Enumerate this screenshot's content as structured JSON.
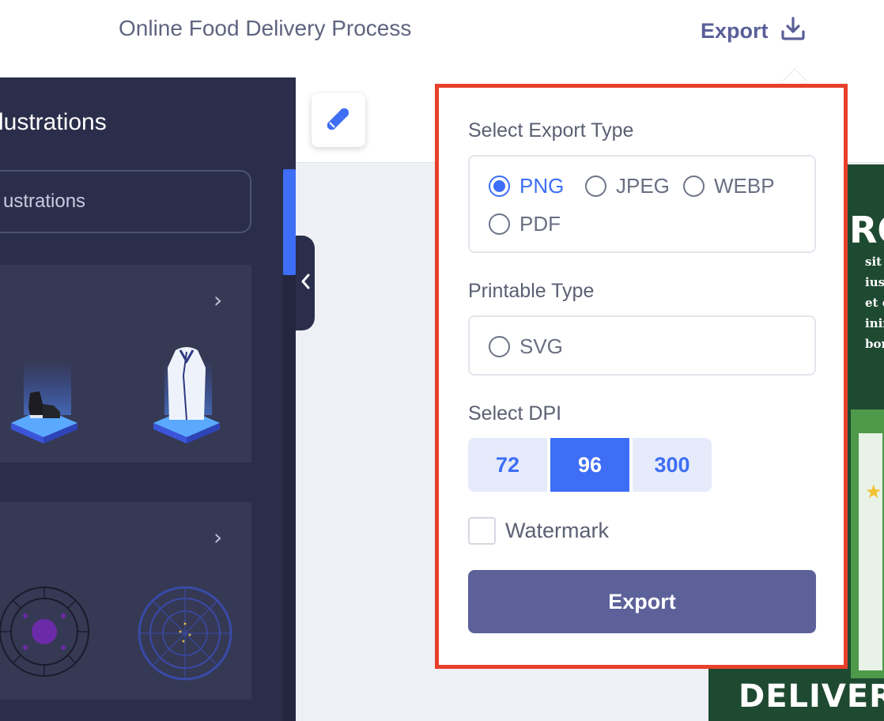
{
  "header": {
    "doc_title": "Online Food Delivery Process",
    "export_label": "Export"
  },
  "sidebar": {
    "title": "lustrations",
    "search_label": "ustrations"
  },
  "poster": {
    "title": "RO",
    "lines": [
      "sit am",
      "iusmo",
      "et do",
      "inim v",
      "boris a"
    ],
    "delivery": "DELIVERY"
  },
  "export_panel": {
    "export_type_label": "Select Export Type",
    "export_types": [
      {
        "label": "PNG",
        "checked": true
      },
      {
        "label": "JPEG",
        "checked": false
      },
      {
        "label": "WEBP",
        "checked": false
      },
      {
        "label": "PDF",
        "checked": false
      }
    ],
    "printable_type_label": "Printable Type",
    "printable_types": [
      {
        "label": "SVG",
        "checked": false
      }
    ],
    "dpi_label": "Select DPI",
    "dpi_options": [
      "72",
      "96",
      "300"
    ],
    "dpi_selected": "96",
    "watermark_label": "Watermark",
    "watermark_checked": false,
    "export_button_label": "Export"
  },
  "colors": {
    "accent": "#3d6ef5",
    "sidebar_bg": "#2b2e4a",
    "export_button": "#5c619a",
    "highlight_border": "#e8402b"
  }
}
